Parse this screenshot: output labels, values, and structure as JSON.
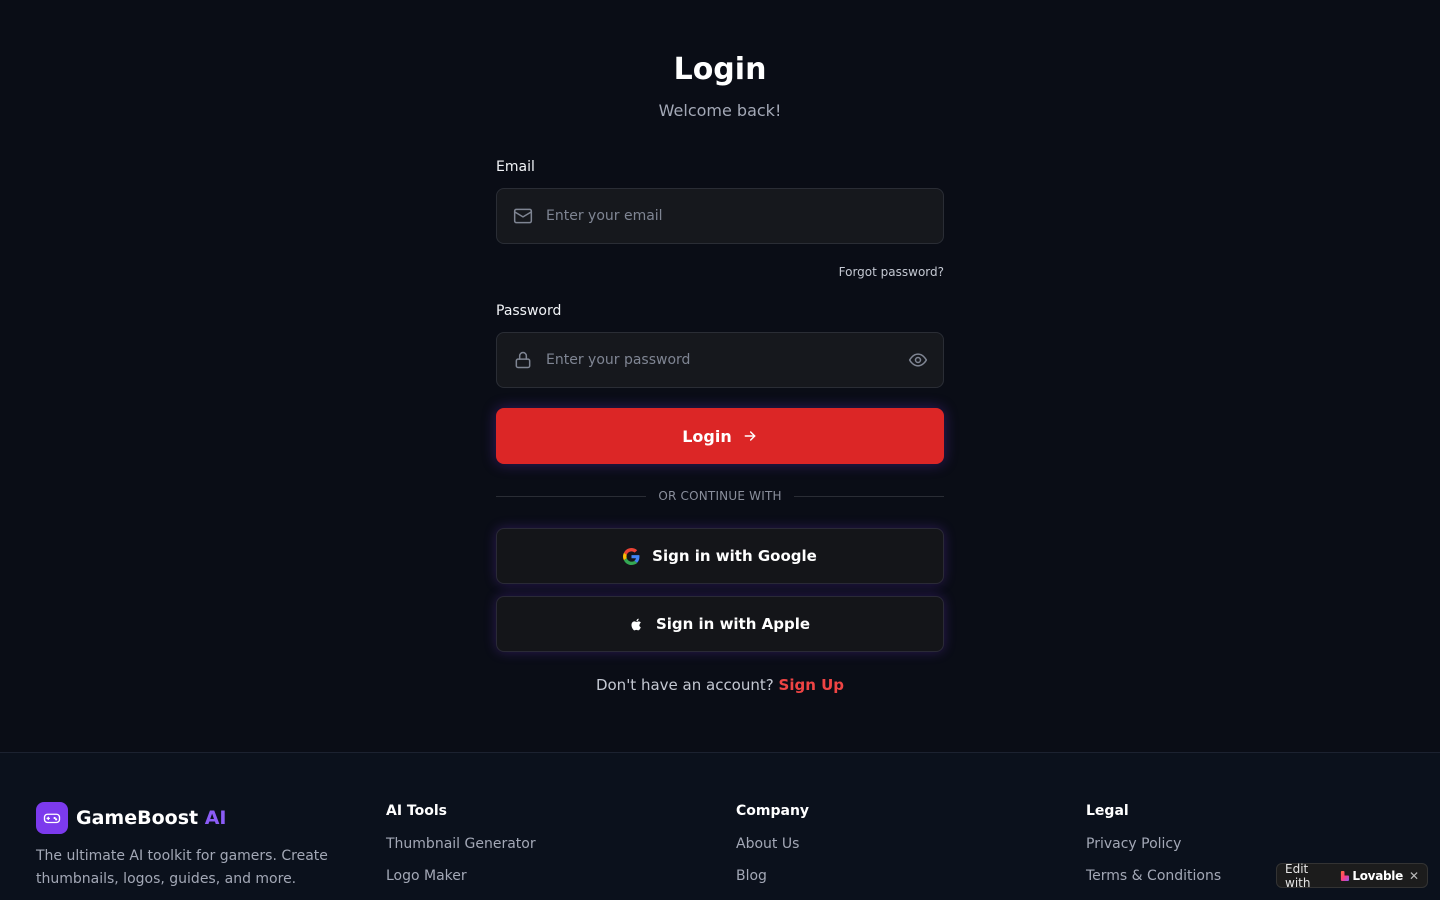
{
  "login": {
    "title": "Login",
    "subtitle": "Welcome back!",
    "email_label": "Email",
    "email_placeholder": "Enter your email",
    "email_value": "",
    "forgot_password": "Forgot password?",
    "password_label": "Password",
    "password_placeholder": "Enter your password",
    "password_value": "",
    "submit_label": "Login",
    "divider_text": "OR CONTINUE WITH",
    "google_label": "Sign in with Google",
    "apple_label": "Sign in with Apple",
    "no_account_text": "Don't have an account?",
    "signup_label": "Sign Up"
  },
  "footer": {
    "brand_name": "GameBoost",
    "brand_accent": "AI",
    "description": "The ultimate AI toolkit for gamers. Create thumbnails, logos, guides, and more.",
    "columns": [
      {
        "heading": "AI Tools",
        "links": [
          "Thumbnail Generator",
          "Logo Maker"
        ]
      },
      {
        "heading": "Company",
        "links": [
          "About Us",
          "Blog"
        ]
      },
      {
        "heading": "Legal",
        "links": [
          "Privacy Policy",
          "Terms & Conditions"
        ]
      }
    ]
  },
  "badge": {
    "prefix": "Edit with",
    "brand": "Lovable",
    "close": "✕"
  },
  "colors": {
    "background": "#0a0d16",
    "primary_red": "#dc2626",
    "link_red": "#ef4444",
    "brand_purple": "#7c3aed",
    "accent_purple": "#8b5cf6"
  },
  "icons": {
    "email": "mail-icon",
    "password": "lock-icon",
    "toggle_password": "eye-icon",
    "submit": "arrow-right-icon",
    "google": "google-icon",
    "apple": "apple-icon",
    "brand": "gamepad-icon",
    "badge": "lovable-heart-icon"
  }
}
